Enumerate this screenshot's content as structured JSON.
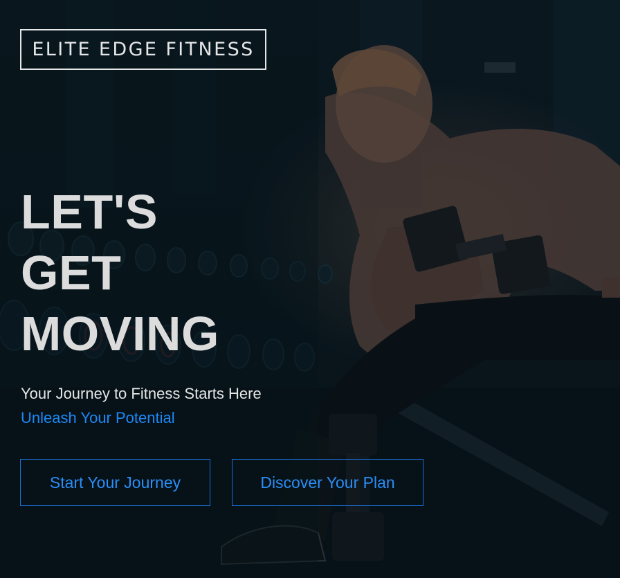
{
  "brand": {
    "logo_text": "ELITE EDGE FITNESS"
  },
  "hero": {
    "headline_lines": [
      "LET'S",
      "GET",
      "MOVING"
    ],
    "subtitle": "Your Journey to Fitness Starts Here",
    "tagline": "Unleash Your Potential",
    "primary_cta": "Start Your Journey",
    "secondary_cta": "Discover Your Plan",
    "background_image": "man-lifting-dumbbell-in-gym-photo"
  },
  "colors": {
    "accent_blue": "#1e88f5",
    "headline": "#dcdcdc",
    "background_dark": "#0c1a20",
    "logo_border": "#e4e6e8"
  }
}
